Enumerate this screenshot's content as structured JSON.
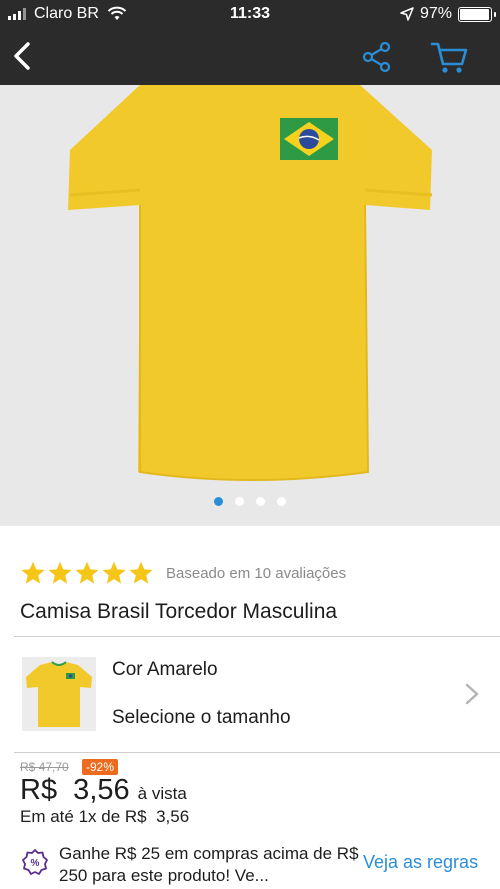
{
  "status_bar": {
    "carrier": "Claro BR",
    "time": "11:33",
    "battery_percent": "97%",
    "battery_level": 0.97
  },
  "nav": {
    "back_icon": "chevron-left-icon",
    "share_icon": "share-icon",
    "cart_icon": "cart-icon"
  },
  "gallery": {
    "total_images": 4,
    "active_index": 0
  },
  "product": {
    "rating_stars": 5,
    "rating_text": "Baseado em 10 avaliações",
    "title": "Camisa Brasil Torcedor Masculina"
  },
  "variant": {
    "color_label": "Cor Amarelo",
    "size_label": "Selecione o tamanho"
  },
  "price": {
    "old_price": "R$ 47,70",
    "discount": "-92%",
    "current": "R$  3,56",
    "payment_mode": "à vista",
    "installments": "Em até 1x de R$  3,56"
  },
  "promo": {
    "text": "Ganhe R$ 25 em compras acima de R$ 250 para este produto! Ve...",
    "link": "Veja as regras"
  },
  "colors": {
    "accent": "#2a8ed6",
    "discount_badge": "#ee6a1e",
    "star": "#f5c518",
    "bar_bg": "#2b2b2b",
    "shirt": "#f2c92a"
  }
}
